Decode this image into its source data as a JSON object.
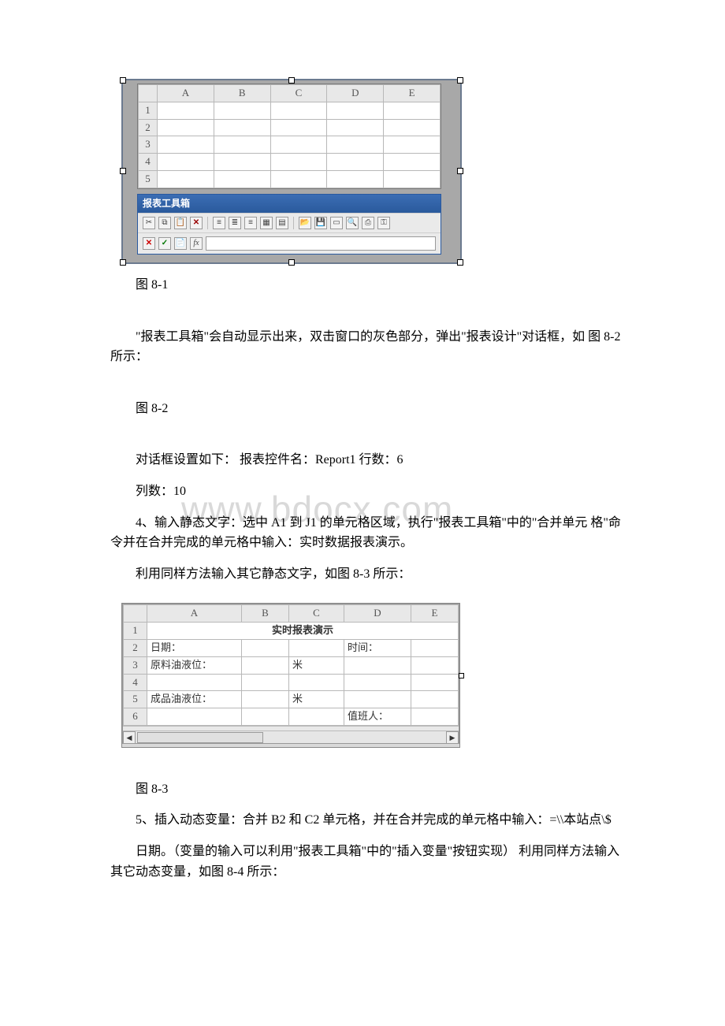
{
  "watermark": "www.bdocx.com",
  "fig81": {
    "columns": [
      "A",
      "B",
      "C",
      "D",
      "E"
    ],
    "rows": [
      "1",
      "2",
      "3",
      "4",
      "5"
    ],
    "toolbox_title": "报表工具箱",
    "row1_icons": [
      "cut-icon",
      "copy-icon",
      "paste-icon",
      "delete-icon",
      "align-left-icon",
      "align-center-icon",
      "align-right-icon",
      "merge-icon",
      "grid-icon",
      "open-icon",
      "save-icon",
      "wizard-icon",
      "preview-icon",
      "print-icon",
      "lock-icon"
    ],
    "row2_icons": [
      "cancel-icon",
      "confirm-icon",
      "var-icon",
      "fx-icon"
    ]
  },
  "caption81": "图 8-1",
  "para1": "\"报表工具箱\"会自动显示出来，双击窗口的灰色部分，弹出\"报表设计\"对话框，如 图 8-2 所示：",
  "caption82": "图 8-2",
  "para2": "对话框设置如下： 报表控件名：Report1 行数：6",
  "para3": "列数：10",
  "para4": "4、输入静态文字：选中 A1 到 J1 的单元格区域，执行\"报表工具箱\"中的\"合并单元 格\"命令并在合并完成的单元格中输入：实时数据报表演示。",
  "para5": "利用同样方法输入其它静态文字，如图 8-3 所示：",
  "fig83": {
    "columns": [
      "A",
      "B",
      "C",
      "D",
      "E"
    ],
    "rows": [
      "1",
      "2",
      "3",
      "4",
      "5",
      "6"
    ],
    "title_cell": "实时报表演示",
    "r2a": "日期：",
    "r2d": "时间：",
    "r3a": "原料油液位：",
    "r3c": "米",
    "r5a": "成品油液位：",
    "r5c": "米",
    "r6d": "值班人：",
    "sb_left": "◀",
    "sb_right": "▶"
  },
  "caption83": "图 8-3",
  "para6": "5、插入动态变量：合并 B2 和 C2 单元格，并在合并完成的单元格中输入：=\\\\本站点\\$",
  "para7": "日期。（变量的输入可以利用\"报表工具箱\"中的\"插入变量\"按钮实现） 利用同样方法输入其它动态变量，如图 8-4 所示："
}
